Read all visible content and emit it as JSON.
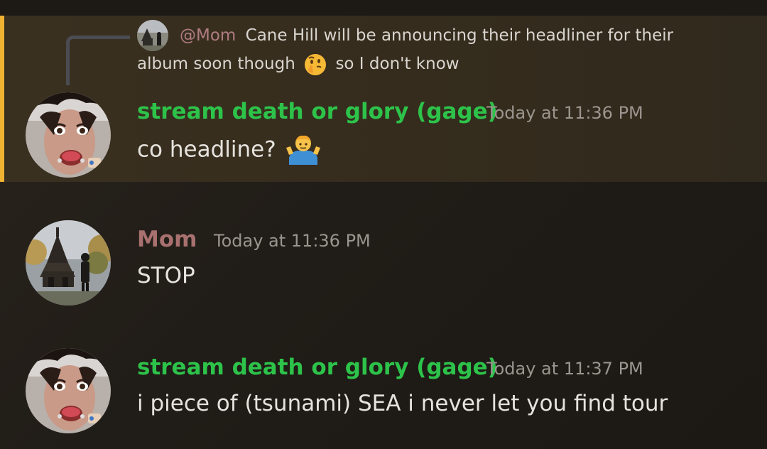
{
  "reply": {
    "mention": "@Mom",
    "text_part1": "Cane Hill will be announcing their headliner for their",
    "text_part2": "album soon though",
    "emoji": "thinking-face",
    "text_part3": "so I don't know"
  },
  "messages": [
    {
      "author": "stream death or glory (gage)",
      "timestamp": "Today at 11:36 PM",
      "content": "co headline?",
      "emoji": "person-shrugging",
      "author_color": "#2dc34a"
    },
    {
      "author": "Mom",
      "timestamp": "Today at 11:36 PM",
      "content": "STOP",
      "author_color": "#a8716f"
    },
    {
      "author": "stream death or glory (gage)",
      "timestamp": "Today at 11:37 PM",
      "content": "i piece of (tsunami) SEA i never let you find tour",
      "author_color": "#2dc34a"
    }
  ],
  "colors": {
    "highlight_bar": "#f0b232",
    "background": "#1f1b16"
  }
}
